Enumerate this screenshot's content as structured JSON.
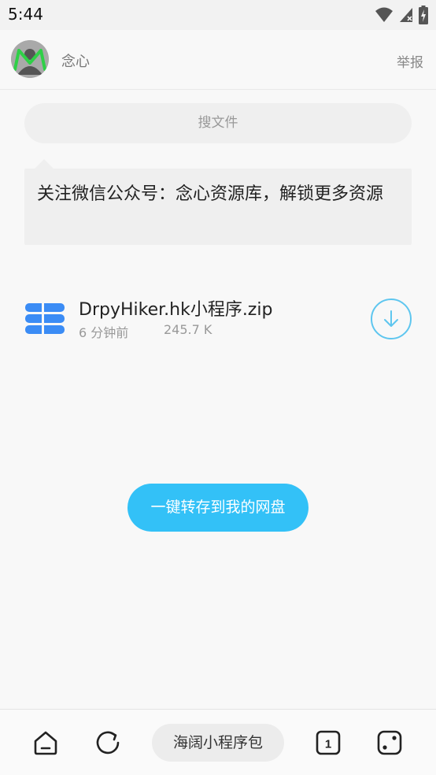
{
  "status_bar": {
    "time": "5:44",
    "icons": [
      "wifi-icon",
      "signal-icon",
      "battery-charging-icon"
    ]
  },
  "header": {
    "username": "念心",
    "report_label": "举报",
    "avatar_icon": "avatar-icon"
  },
  "search": {
    "placeholder": "搜文件"
  },
  "notice": {
    "text": "关注微信公众号：念心资源库，解锁更多资源"
  },
  "file": {
    "name": "DrpyHiker.hk小程序.zip",
    "time": "6 分钟前",
    "size": "245.7 K",
    "icon": "file-package-icon",
    "download_icon": "download-icon"
  },
  "save_button": {
    "label": "一键转存到我的网盘"
  },
  "bottom_nav": {
    "home_icon": "home-icon",
    "refresh_icon": "refresh-icon",
    "pill_label": "海阔小程序包",
    "tabs_count": "1",
    "dice_icon": "dice-icon"
  },
  "colors": {
    "accent": "#33c1f7",
    "download_outline": "#5ec6ef",
    "file_icon": "#3b8cf5"
  }
}
